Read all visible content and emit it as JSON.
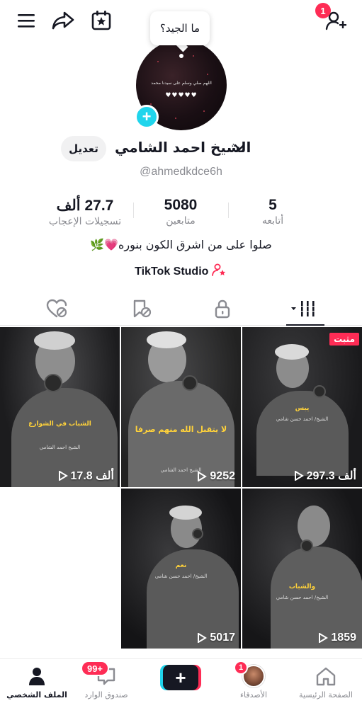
{
  "topbar": {
    "menu_icon": "hamburger-icon",
    "share_icon": "share-icon",
    "calendar_icon": "calendar-star-icon",
    "add_friend_icon": "add-friend-icon",
    "add_friend_badge": "1"
  },
  "profile": {
    "bubble_text": "ما الجيد؟",
    "avatar_caption": "اللهم صلي وسلم على سيدنا محمد",
    "avatar_hearts": "♥♥♥♥♥",
    "display_name": "الشيخ احمد الشامي",
    "edit_label": "تعديل",
    "handle": "@ahmedkdce6h",
    "bio": "صلوا على من اشرق الكون بنوره💗🌿",
    "studio_label": "TikTok Studio"
  },
  "stats": {
    "likes": {
      "value": "27.7 ألف",
      "label": "تسجيلات الإعجاب"
    },
    "followers": {
      "value": "5080",
      "label": "متابعين"
    },
    "following": {
      "value": "5",
      "label": "أتابعه"
    }
  },
  "tabs": [
    {
      "name": "liked",
      "icon": "heart-hidden-icon"
    },
    {
      "name": "favorites",
      "icon": "bookmark-hidden-icon"
    },
    {
      "name": "private",
      "icon": "lock-icon"
    },
    {
      "name": "videos",
      "icon": "grid-icon",
      "active": true
    }
  ],
  "videos": [
    {
      "views": "297.3 ألف",
      "pinned": "مثبت",
      "caption": "يبس",
      "sub": "الشيخ/ احمد حسن شامي"
    },
    {
      "views": "9252",
      "caption": "لا يتقبل الله منهم صرفا",
      "sub": "الشيخ احمد الشامي"
    },
    {
      "views": "17.8 ألف",
      "caption": "الشباب في الشوارع",
      "sub": "الشيخ احمد الشامي"
    },
    {
      "views": "1859",
      "caption": "والشباب",
      "sub": "الشيخ/ احمد حسن شامي"
    },
    {
      "views": "5017",
      "caption": "نعم",
      "sub": "الشيخ/ احمد حسن شامي"
    }
  ],
  "nav": {
    "home": "الصفحة الرئيسية",
    "friends": "الأصدقاء",
    "friends_badge": "1",
    "inbox": "صندوق الوارد",
    "inbox_badge": "99+",
    "profile": "الملف الشخصي"
  },
  "colors": {
    "accent": "#fe2c55",
    "cyan": "#20d5ec",
    "caption": "#ffd23a"
  }
}
